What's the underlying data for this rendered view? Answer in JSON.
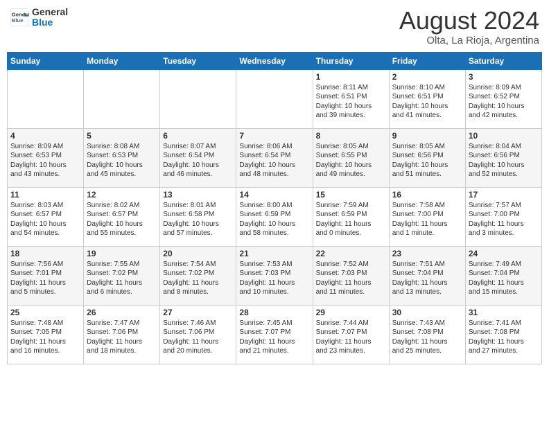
{
  "header": {
    "logo_line1": "General",
    "logo_line2": "Blue",
    "month": "August 2024",
    "location": "Olta, La Rioja, Argentina"
  },
  "weekdays": [
    "Sunday",
    "Monday",
    "Tuesday",
    "Wednesday",
    "Thursday",
    "Friday",
    "Saturday"
  ],
  "weeks": [
    [
      {
        "day": "",
        "info": ""
      },
      {
        "day": "",
        "info": ""
      },
      {
        "day": "",
        "info": ""
      },
      {
        "day": "",
        "info": ""
      },
      {
        "day": "1",
        "info": "Sunrise: 8:11 AM\nSunset: 6:51 PM\nDaylight: 10 hours\nand 39 minutes."
      },
      {
        "day": "2",
        "info": "Sunrise: 8:10 AM\nSunset: 6:51 PM\nDaylight: 10 hours\nand 41 minutes."
      },
      {
        "day": "3",
        "info": "Sunrise: 8:09 AM\nSunset: 6:52 PM\nDaylight: 10 hours\nand 42 minutes."
      }
    ],
    [
      {
        "day": "4",
        "info": "Sunrise: 8:09 AM\nSunset: 6:53 PM\nDaylight: 10 hours\nand 43 minutes."
      },
      {
        "day": "5",
        "info": "Sunrise: 8:08 AM\nSunset: 6:53 PM\nDaylight: 10 hours\nand 45 minutes."
      },
      {
        "day": "6",
        "info": "Sunrise: 8:07 AM\nSunset: 6:54 PM\nDaylight: 10 hours\nand 46 minutes."
      },
      {
        "day": "7",
        "info": "Sunrise: 8:06 AM\nSunset: 6:54 PM\nDaylight: 10 hours\nand 48 minutes."
      },
      {
        "day": "8",
        "info": "Sunrise: 8:05 AM\nSunset: 6:55 PM\nDaylight: 10 hours\nand 49 minutes."
      },
      {
        "day": "9",
        "info": "Sunrise: 8:05 AM\nSunset: 6:56 PM\nDaylight: 10 hours\nand 51 minutes."
      },
      {
        "day": "10",
        "info": "Sunrise: 8:04 AM\nSunset: 6:56 PM\nDaylight: 10 hours\nand 52 minutes."
      }
    ],
    [
      {
        "day": "11",
        "info": "Sunrise: 8:03 AM\nSunset: 6:57 PM\nDaylight: 10 hours\nand 54 minutes."
      },
      {
        "day": "12",
        "info": "Sunrise: 8:02 AM\nSunset: 6:57 PM\nDaylight: 10 hours\nand 55 minutes."
      },
      {
        "day": "13",
        "info": "Sunrise: 8:01 AM\nSunset: 6:58 PM\nDaylight: 10 hours\nand 57 minutes."
      },
      {
        "day": "14",
        "info": "Sunrise: 8:00 AM\nSunset: 6:59 PM\nDaylight: 10 hours\nand 58 minutes."
      },
      {
        "day": "15",
        "info": "Sunrise: 7:59 AM\nSunset: 6:59 PM\nDaylight: 11 hours\nand 0 minutes."
      },
      {
        "day": "16",
        "info": "Sunrise: 7:58 AM\nSunset: 7:00 PM\nDaylight: 11 hours\nand 1 minute."
      },
      {
        "day": "17",
        "info": "Sunrise: 7:57 AM\nSunset: 7:00 PM\nDaylight: 11 hours\nand 3 minutes."
      }
    ],
    [
      {
        "day": "18",
        "info": "Sunrise: 7:56 AM\nSunset: 7:01 PM\nDaylight: 11 hours\nand 5 minutes."
      },
      {
        "day": "19",
        "info": "Sunrise: 7:55 AM\nSunset: 7:02 PM\nDaylight: 11 hours\nand 6 minutes."
      },
      {
        "day": "20",
        "info": "Sunrise: 7:54 AM\nSunset: 7:02 PM\nDaylight: 11 hours\nand 8 minutes."
      },
      {
        "day": "21",
        "info": "Sunrise: 7:53 AM\nSunset: 7:03 PM\nDaylight: 11 hours\nand 10 minutes."
      },
      {
        "day": "22",
        "info": "Sunrise: 7:52 AM\nSunset: 7:03 PM\nDaylight: 11 hours\nand 11 minutes."
      },
      {
        "day": "23",
        "info": "Sunrise: 7:51 AM\nSunset: 7:04 PM\nDaylight: 11 hours\nand 13 minutes."
      },
      {
        "day": "24",
        "info": "Sunrise: 7:49 AM\nSunset: 7:04 PM\nDaylight: 11 hours\nand 15 minutes."
      }
    ],
    [
      {
        "day": "25",
        "info": "Sunrise: 7:48 AM\nSunset: 7:05 PM\nDaylight: 11 hours\nand 16 minutes."
      },
      {
        "day": "26",
        "info": "Sunrise: 7:47 AM\nSunset: 7:06 PM\nDaylight: 11 hours\nand 18 minutes."
      },
      {
        "day": "27",
        "info": "Sunrise: 7:46 AM\nSunset: 7:06 PM\nDaylight: 11 hours\nand 20 minutes."
      },
      {
        "day": "28",
        "info": "Sunrise: 7:45 AM\nSunset: 7:07 PM\nDaylight: 11 hours\nand 21 minutes."
      },
      {
        "day": "29",
        "info": "Sunrise: 7:44 AM\nSunset: 7:07 PM\nDaylight: 11 hours\nand 23 minutes."
      },
      {
        "day": "30",
        "info": "Sunrise: 7:43 AM\nSunset: 7:08 PM\nDaylight: 11 hours\nand 25 minutes."
      },
      {
        "day": "31",
        "info": "Sunrise: 7:41 AM\nSunset: 7:08 PM\nDaylight: 11 hours\nand 27 minutes."
      }
    ]
  ]
}
